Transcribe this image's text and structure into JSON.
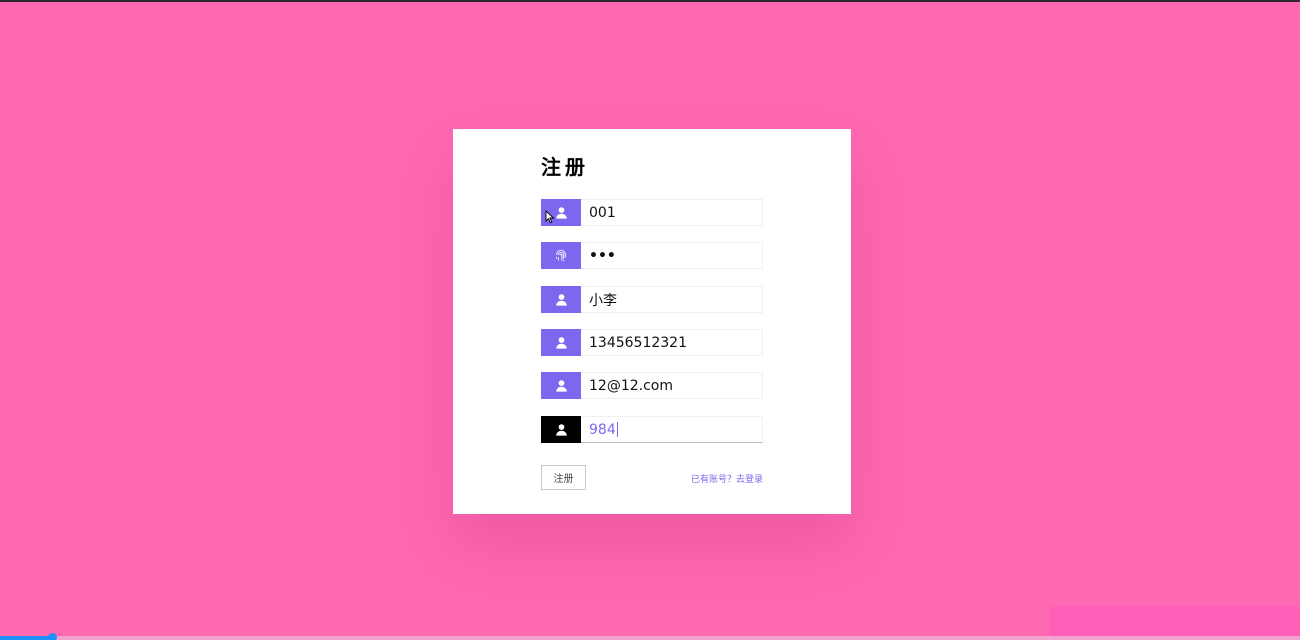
{
  "form": {
    "title": "注册",
    "fields": [
      {
        "icon": "user-icon",
        "value": "001"
      },
      {
        "icon": "fingerprint-icon",
        "value": "•••"
      },
      {
        "icon": "user-icon",
        "value": "小李"
      },
      {
        "icon": "user-icon",
        "value": "13456512321"
      },
      {
        "icon": "user-icon",
        "value": "12@12.com"
      },
      {
        "icon": "user-icon",
        "value": "984"
      }
    ],
    "submit_label": "注册",
    "login_link": "已有账号？去登录"
  },
  "media": {
    "progress_fraction": 0.04
  },
  "colors": {
    "background": "#ff69b2",
    "accent": "#7b68ee",
    "active_icon": "#000000",
    "progress": "#1e90ff"
  }
}
